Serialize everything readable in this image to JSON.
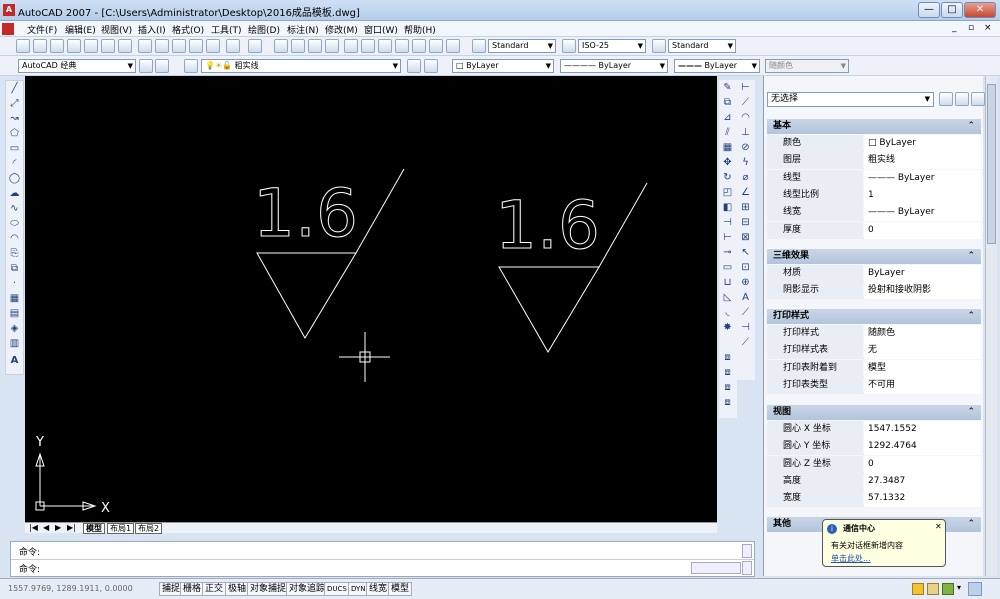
{
  "window": {
    "title": "AutoCAD 2007 - [C:\\Users\\Administrator\\Desktop\\2016成品模板.dwg]",
    "min": "—",
    "max": "□",
    "close": "✕",
    "doc_min": "_",
    "doc_max": "▫",
    "doc_close": "×"
  },
  "menu": [
    "文件(F)",
    "编辑(E)",
    "视图(V)",
    "插入(I)",
    "格式(O)",
    "工具(T)",
    "绘图(D)",
    "标注(N)",
    "修改(M)",
    "窗口(W)",
    "帮助(H)"
  ],
  "toolbar": {
    "text_style": "Standard",
    "dim_style": "ISO-25",
    "table_style": "Standard",
    "workspace": "AutoCAD 经典",
    "layer": "粗实线",
    "color": "ByLayer",
    "linetype": "ByLayer",
    "lineweight": "ByLayer",
    "plotstyle": "随颜色"
  },
  "canvas": {
    "annotation1": "1.6",
    "annotation2": "1.6",
    "ucs_x": "X",
    "ucs_y": "Y"
  },
  "tabs": {
    "nav": [
      "|◀",
      "◀",
      "▶",
      "▶|"
    ],
    "items": [
      "模型",
      "布局1",
      "布局2"
    ]
  },
  "command": {
    "line1": "命令:",
    "line2": "命令:"
  },
  "status": {
    "coords": "1557.9769, 1289.1911, 0.0000",
    "buttons": [
      "捕捉",
      "栅格",
      "正交",
      "极轴",
      "对象捕捉",
      "对象追踪",
      "DUCS",
      "DYN",
      "线宽",
      "模型"
    ]
  },
  "properties": {
    "selection": "无选择",
    "sections": [
      {
        "title": "基本",
        "rows": [
          {
            "k": "颜色",
            "v": "□ ByLayer"
          },
          {
            "k": "图层",
            "v": "粗实线"
          },
          {
            "k": "线型",
            "v": "——— ByLayer"
          },
          {
            "k": "线型比例",
            "v": "1"
          },
          {
            "k": "线宽",
            "v": "——— ByLayer"
          },
          {
            "k": "厚度",
            "v": "0"
          }
        ]
      },
      {
        "title": "三维效果",
        "rows": [
          {
            "k": "材质",
            "v": "ByLayer"
          },
          {
            "k": "阴影显示",
            "v": "投射和接收阴影"
          }
        ]
      },
      {
        "title": "打印样式",
        "rows": [
          {
            "k": "打印样式",
            "v": "随颜色"
          },
          {
            "k": "打印样式表",
            "v": "无"
          },
          {
            "k": "打印表附着到",
            "v": "模型"
          },
          {
            "k": "打印表类型",
            "v": "不可用"
          }
        ]
      },
      {
        "title": "视图",
        "rows": [
          {
            "k": "圆心 X 坐标",
            "v": "1547.1552"
          },
          {
            "k": "圆心 Y 坐标",
            "v": "1292.4764"
          },
          {
            "k": "圆心 Z 坐标",
            "v": "0"
          },
          {
            "k": "高度",
            "v": "27.3487"
          },
          {
            "k": "宽度",
            "v": "57.1332"
          }
        ]
      },
      {
        "title": "其他",
        "rows": []
      }
    ]
  },
  "popup": {
    "title": "通信中心",
    "body": "有关对话框新增内容",
    "link": "单击此处..."
  },
  "colors": {
    "canvas": "#000000",
    "lines": "#ffffff"
  }
}
